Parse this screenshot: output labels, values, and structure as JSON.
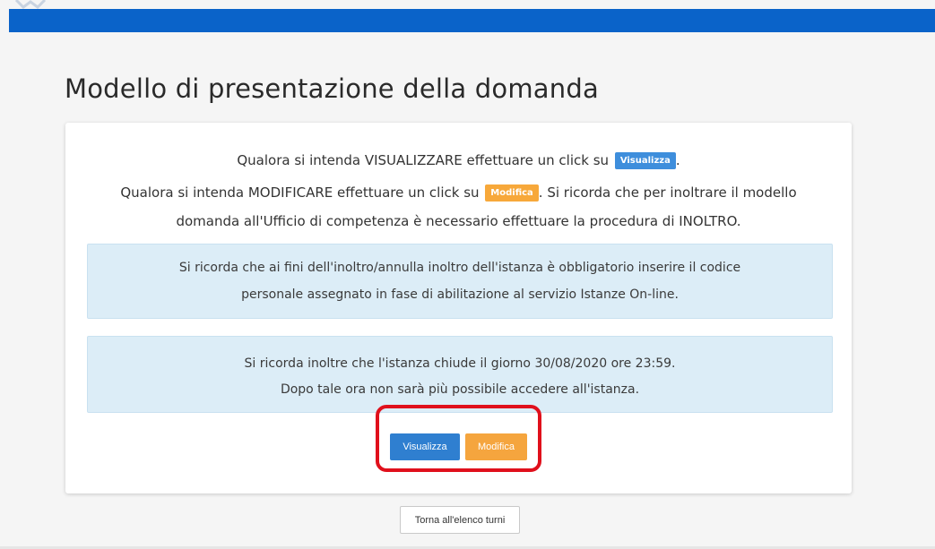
{
  "header": {
    "color": "#0a63c9",
    "logo_icon": "emblem-icon"
  },
  "page": {
    "title": "Modello di presentazione della domanda"
  },
  "instructions": {
    "view_text_before": "Qualora si intenda VISUALIZZARE effettuare un click su",
    "view_button_label": "Visualizza",
    "view_text_after": ".",
    "edit_text_before": "Qualora si intenda MODIFICARE effettuare un click su",
    "edit_button_label": "Modifica",
    "edit_text_after": ". Si ricorda che per inoltrare il modello",
    "edit_text_line2": "domanda all'Ufficio di competenza è necessario effettuare la procedura di INOLTRO."
  },
  "notices": [
    {
      "line1": "Si ricorda che ai fini dell'inoltro/annulla inoltro dell'istanza è obbligatorio inserire il codice",
      "line2": "personale assegnato in fase di abilitazione al servizio Istanze On-line."
    },
    {
      "line1": "Si ricorda inoltre che l'istanza chiude il giorno 30/08/2020 ore 23:59.",
      "line2": "Dopo tale ora non sarà più possibile accedere all'istanza."
    }
  ],
  "actions": {
    "view_label": "Visualizza",
    "edit_label": "Modifica",
    "highlight_color": "#e0101c"
  },
  "footer": {
    "back_label": "Torna all'elenco turni"
  },
  "colors": {
    "primary": "#2f7fd0",
    "warning": "#f5a53e",
    "info_bg": "#dcedf7"
  }
}
